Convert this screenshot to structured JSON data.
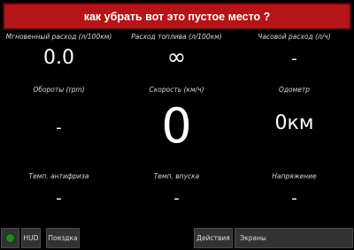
{
  "banner": {
    "text": "как убрать вот это пустое место ?"
  },
  "gauges": [
    {
      "label": "Мгновенный расход (л/100км)",
      "value": "0.0"
    },
    {
      "label": "Расход топлива (л/100км)",
      "value": "∞"
    },
    {
      "label": "Часовой расход (л/ч)",
      "value": "-"
    },
    {
      "label": "Обороты (rpm)",
      "value": "-"
    },
    {
      "label": "Скорость (км/ч)",
      "value": "0"
    },
    {
      "label": "Одометр",
      "value": "0км"
    },
    {
      "label": "Темп. антифриза",
      "value": "-"
    },
    {
      "label": "Темп. впуска",
      "value": "-"
    },
    {
      "label": "Напряжение",
      "value": "-"
    }
  ],
  "toolbar": {
    "status_indicator_color": "#1f8a1f",
    "hud_label": "HUD",
    "trip_label": "Поездка",
    "actions_label": "Действия",
    "screens_label": "Экраны"
  }
}
